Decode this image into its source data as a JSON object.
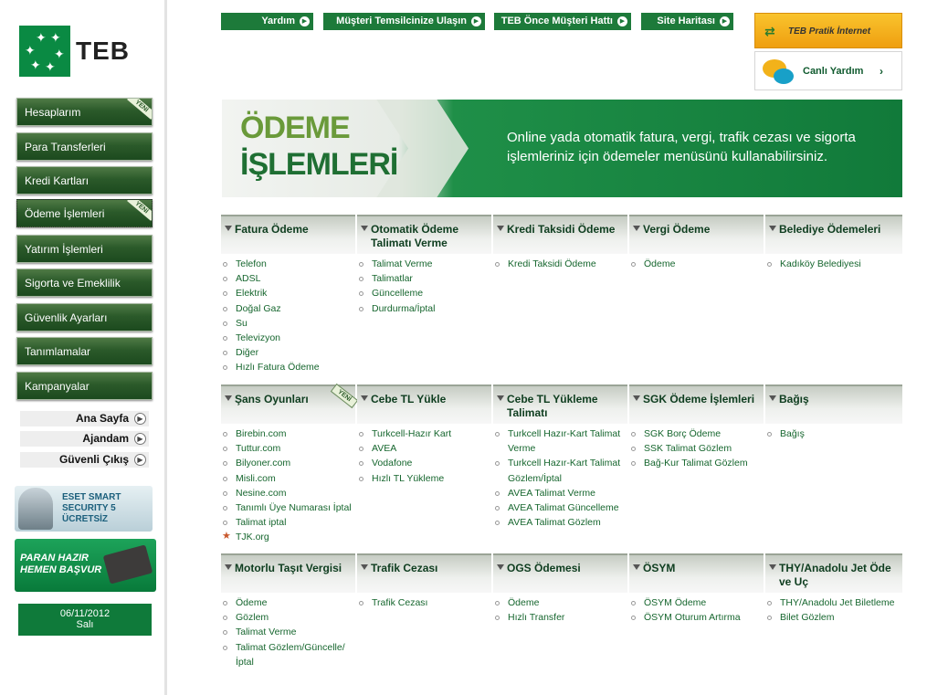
{
  "brand": {
    "name": "TEB"
  },
  "sidebar": {
    "nav": [
      {
        "label": "Hesaplarım",
        "new": true
      },
      {
        "label": "Para Transferleri",
        "new": false
      },
      {
        "label": "Kredi Kartları",
        "new": false
      },
      {
        "label": "Ödeme İşlemleri",
        "new": true,
        "active": true
      },
      {
        "label": "Yatırım İşlemleri",
        "new": false
      },
      {
        "label": "Sigorta ve Emeklilik",
        "new": false
      },
      {
        "label": "Güvenlik Ayarları",
        "new": false
      },
      {
        "label": "Tanımlamalar",
        "new": false
      },
      {
        "label": "Kampanyalar",
        "new": false
      }
    ],
    "yeni_badge": "YENİ",
    "links": [
      "Ana Sayfa",
      "Ajandam",
      "Güvenli Çıkış"
    ],
    "eset": {
      "line1": "ESET SMART",
      "line2": "SECURITY 5",
      "line3": "ÜCRETSİZ"
    },
    "promo": {
      "line1": "PARAN HAZIR",
      "line2": "HEMEN BAŞVUR"
    },
    "date": "06/11/2012",
    "day": "Salı"
  },
  "toplinks": [
    "Yardım",
    "Müşteri Temsilcinize Ulaşın",
    "TEB Önce Müşteri Hattı",
    "Site Haritası"
  ],
  "pratik": "TEB Pratik İnternet Şubesi",
  "canli": "Canlı Yardım",
  "banner": {
    "title1": "ÖDEME",
    "title2": "İŞLEMLERİ",
    "desc": "Online yada otomatik fatura, vergi, trafik cezası ve sigorta işlemleriniz için ödemeler menüsünü kullanabilirsiniz."
  },
  "categories": [
    {
      "title": "Fatura Ödeme",
      "items": [
        "Telefon",
        "ADSL",
        "Elektrik",
        "Doğal Gaz",
        "Su",
        "Televizyon",
        "Diğer",
        "Hızlı Fatura Ödeme"
      ]
    },
    {
      "title": "Otomatik Ödeme Talimatı Verme",
      "items": [
        "Talimat Verme",
        "Talimatlar",
        "Güncelleme",
        "Durdurma/İptal"
      ]
    },
    {
      "title": "Kredi Taksidi Ödeme",
      "items": [
        "Kredi Taksidi Ödeme"
      ]
    },
    {
      "title": "Vergi Ödeme",
      "items": [
        "Ödeme"
      ]
    },
    {
      "title": "Belediye Ödemeleri",
      "items": [
        "Kadıköy Belediyesi"
      ]
    },
    {
      "title": "Şans Oyunları",
      "new": true,
      "items": [
        "Birebin.com",
        "Tuttur.com",
        "Bilyoner.com",
        "Misli.com",
        "Nesine.com",
        "Tanımlı Üye Numarası İptal",
        "Talimat iptal",
        "TJK.org"
      ]
    },
    {
      "title": "Cebe TL Yükle",
      "items": [
        "Turkcell-Hazır Kart",
        "AVEA",
        "Vodafone",
        "Hızlı TL Yükleme"
      ]
    },
    {
      "title": "Cebe TL Yükleme Talimatı",
      "items": [
        "Turkcell Hazır-Kart Talimat Verme",
        "Turkcell Hazır-Kart Talimat Gözlem/İptal",
        "AVEA Talimat Verme",
        "AVEA Talimat Güncelleme",
        "AVEA Talimat Gözlem"
      ]
    },
    {
      "title": "SGK Ödeme İşlemleri",
      "items": [
        "SGK Borç Ödeme",
        "SSK Talimat Gözlem",
        "Bağ-Kur Talimat Gözlem"
      ]
    },
    {
      "title": "Bağış",
      "items": [
        "Bağış"
      ]
    },
    {
      "title": "Motorlu Taşıt Vergisi",
      "items": [
        "Ödeme",
        "Gözlem",
        "Talimat Verme",
        "Talimat Gözlem/Güncelle/İptal"
      ]
    },
    {
      "title": "Trafik Cezası",
      "items": [
        "Trafik Cezası"
      ]
    },
    {
      "title": "OGS Ödemesi",
      "items": [
        "Ödeme",
        "Hızlı Transfer"
      ]
    },
    {
      "title": "ÖSYM",
      "items": [
        "ÖSYM Ödeme",
        "ÖSYM Oturum Artırma"
      ]
    },
    {
      "title": "THY/Anadolu Jet Öde ve Uç",
      "items": [
        "THY/Anadolu Jet Biletleme",
        "Bilet Gözlem"
      ]
    }
  ]
}
